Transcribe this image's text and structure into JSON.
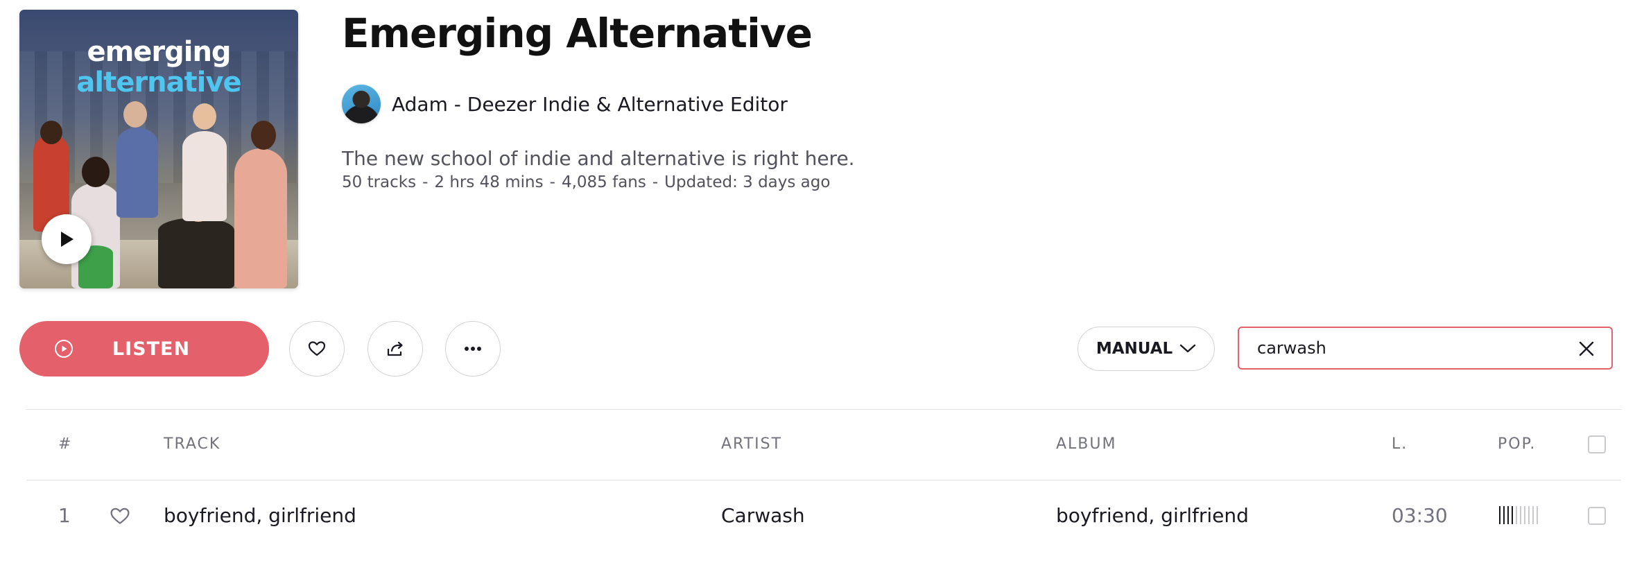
{
  "cover": {
    "title_line1": "emerging",
    "title_line2": "alternative",
    "accent_color": "#4fc6ef",
    "play_icon": "play-icon"
  },
  "playlist": {
    "title": "Emerging Alternative",
    "author": "Adam - Deezer Indie & Alternative Editor",
    "description": "The new school of indie and alternative is right here.",
    "meta": {
      "tracks": "50 tracks",
      "duration": "2 hrs 48 mins",
      "fans": "4,085 fans",
      "updated": "Updated: 3 days ago",
      "separator": "-"
    }
  },
  "actions": {
    "listen_label": "LISTEN",
    "listen_color": "#e4606a",
    "favorite_icon": "heart-icon",
    "share_icon": "share-icon",
    "more_icon": "more-icon",
    "sort_label": "MANUAL",
    "search_value": "carwash",
    "search_border_color": "#e4606a"
  },
  "table": {
    "headers": {
      "index": "#",
      "track": "TRACK",
      "artist": "ARTIST",
      "album": "ALBUM",
      "length": "L.",
      "popularity": "POP."
    },
    "rows": [
      {
        "index": "1",
        "track": "boyfriend, girlfriend",
        "artist": "Carwash",
        "album": "boyfriend, girlfriend",
        "length": "03:30",
        "popularity_bars_on": 4,
        "popularity_bars_total": 10
      }
    ]
  }
}
